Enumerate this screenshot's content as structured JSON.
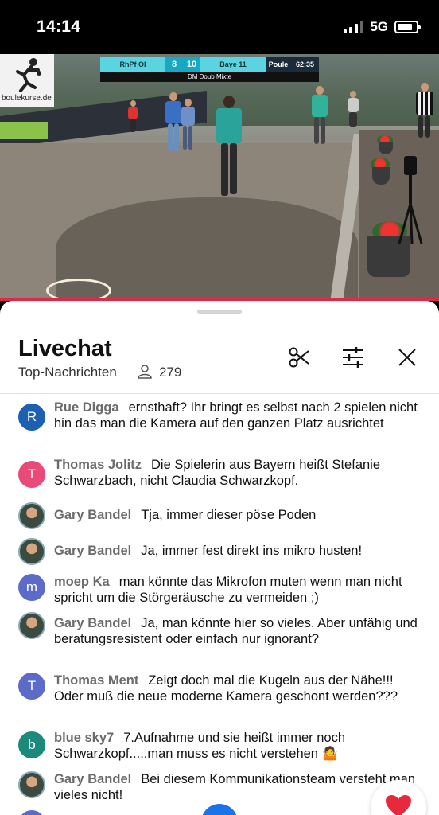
{
  "status_bar": {
    "time": "14:14",
    "network": "5G"
  },
  "video": {
    "logo_text": "boulekurse.de",
    "scoreboard": {
      "team1": "RhPf OI",
      "score1": "8",
      "score2": "10",
      "team2": "Baye 11",
      "phase": "Poule",
      "clock": "62:35",
      "event": "DM Doub Mixte"
    }
  },
  "chat": {
    "title": "Livechat",
    "subtitle": "Top-Nachrichten",
    "viewer_count": "279",
    "icons": [
      "scissors-icon",
      "filter-sliders-icon",
      "close-icon",
      "heart-icon"
    ],
    "messages": [
      {
        "initial": "R",
        "avatar_color": "#1d5fb0",
        "author": "Rue Digga",
        "text": "ernsthaft? Ihr bringt es selbst nach 2 spielen nicht hin das man die Kamera auf den ganzen Platz ausrichtet"
      },
      {
        "initial": "T",
        "avatar_color": "#e84b7a",
        "author": "Thomas Jolitz",
        "text": "Die Spielerin aus Bayern heißt Stefanie Schwarzbach, nicht Claudia Schwarzkopf."
      },
      {
        "initial": "",
        "avatar_color": "photo",
        "author": "Gary Bandel",
        "text": "Tja, immer dieser pöse Poden"
      },
      {
        "initial": "",
        "avatar_color": "photo",
        "author": "Gary Bandel",
        "text": "Ja, immer fest direkt ins mikro husten!"
      },
      {
        "initial": "m",
        "avatar_color": "#5b6bc7",
        "author": "moep Ka",
        "text": "man könnte das Mikrofon muten wenn man nicht spricht um die Störgeräusche zu vermeiden ;)"
      },
      {
        "initial": "",
        "avatar_color": "photo",
        "author": "Gary Bandel",
        "text": "Ja, man könnte hier so vieles. Aber unfähig und beratungsresistent oder einfach nur ignorant?"
      },
      {
        "initial": "T",
        "avatar_color": "#5b6bc7",
        "author": "Thomas Ment",
        "text": "Zeigt doch mal die Kugeln aus der Nähe!!! Oder muß die neue moderne Kamera geschont werden???"
      },
      {
        "initial": "b",
        "avatar_color": "#1b8a7a",
        "author": "blue sky7",
        "text": "7.Aufnahme und sie heißt immer noch Schwarzkopf.....man muss es nicht verstehen 🤷"
      },
      {
        "initial": "",
        "avatar_color": "photo",
        "author": "Gary Bandel",
        "text": "Bei diesem Kommunikationsteam versteht man vieles nicht!"
      }
    ]
  }
}
